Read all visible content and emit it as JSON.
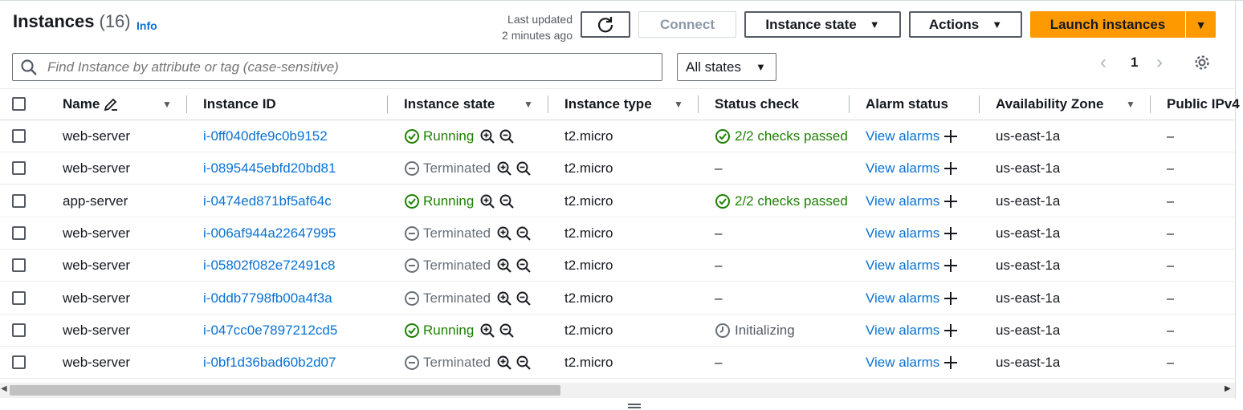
{
  "header": {
    "title": "Instances",
    "count": "(16)",
    "info_label": "Info",
    "last_updated_line1": "Last updated",
    "last_updated_line2": "2 minutes ago",
    "connect_label": "Connect",
    "instance_state_label": "Instance state",
    "actions_label": "Actions",
    "launch_label": "Launch instances"
  },
  "filters": {
    "search_placeholder": "Find Instance by attribute or tag (case-sensitive)",
    "state_filter": "All states",
    "page_number": "1"
  },
  "columns": {
    "name": "Name",
    "instance_id": "Instance ID",
    "instance_state": "Instance state",
    "instance_type": "Instance type",
    "status_check": "Status check",
    "alarm_status": "Alarm status",
    "availability_zone": "Availability Zone",
    "public_ipv4": "Public IPv4"
  },
  "rows": [
    {
      "name": "web-server",
      "id": "i-0ff040dfe9c0b9152",
      "state": "Running",
      "type": "t2.micro",
      "status": "2/2 checks passed",
      "alarm": "View alarms",
      "az": "us-east-1a",
      "ip": "–"
    },
    {
      "name": "web-server",
      "id": "i-0895445ebfd20bd81",
      "state": "Terminated",
      "type": "t2.micro",
      "status": "–",
      "alarm": "View alarms",
      "az": "us-east-1a",
      "ip": "–"
    },
    {
      "name": "app-server",
      "id": "i-0474ed871bf5af64c",
      "state": "Running",
      "type": "t2.micro",
      "status": "2/2 checks passed",
      "alarm": "View alarms",
      "az": "us-east-1a",
      "ip": "–"
    },
    {
      "name": "web-server",
      "id": "i-006af944a22647995",
      "state": "Terminated",
      "type": "t2.micro",
      "status": "–",
      "alarm": "View alarms",
      "az": "us-east-1a",
      "ip": "–"
    },
    {
      "name": "web-server",
      "id": "i-05802f082e72491c8",
      "state": "Terminated",
      "type": "t2.micro",
      "status": "–",
      "alarm": "View alarms",
      "az": "us-east-1a",
      "ip": "–"
    },
    {
      "name": "web-server",
      "id": "i-0ddb7798fb00a4f3a",
      "state": "Terminated",
      "type": "t2.micro",
      "status": "–",
      "alarm": "View alarms",
      "az": "us-east-1a",
      "ip": "–"
    },
    {
      "name": "web-server",
      "id": "i-047cc0e7897212cd5",
      "state": "Running",
      "type": "t2.micro",
      "status": "Initializing",
      "alarm": "View alarms",
      "az": "us-east-1a",
      "ip": "–"
    },
    {
      "name": "web-server",
      "id": "i-0bf1d36bad60b2d07",
      "state": "Terminated",
      "type": "t2.micro",
      "status": "–",
      "alarm": "View alarms",
      "az": "us-east-1a",
      "ip": "–"
    }
  ],
  "colors": {
    "accent": "#ff9900",
    "link": "#0972d3",
    "success": "#1d8102",
    "muted": "#687078"
  }
}
